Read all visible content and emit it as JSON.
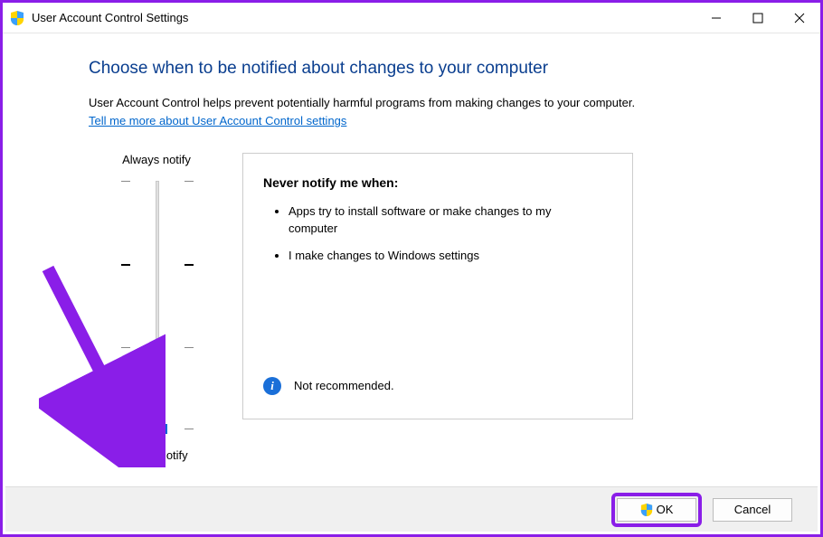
{
  "window": {
    "title": "User Account Control Settings"
  },
  "heading": "Choose when to be notified about changes to your computer",
  "description": "User Account Control helps prevent potentially harmful programs from making changes to your computer.",
  "link_text": "Tell me more about User Account Control settings",
  "slider": {
    "label_top": "Always notify",
    "label_bottom": "Never notify"
  },
  "info": {
    "heading": "Never notify me when:",
    "bullets": [
      "Apps try to install software or make changes to my computer",
      "I make changes to Windows settings"
    ],
    "note": "Not recommended."
  },
  "buttons": {
    "ok": "OK",
    "cancel": "Cancel"
  }
}
